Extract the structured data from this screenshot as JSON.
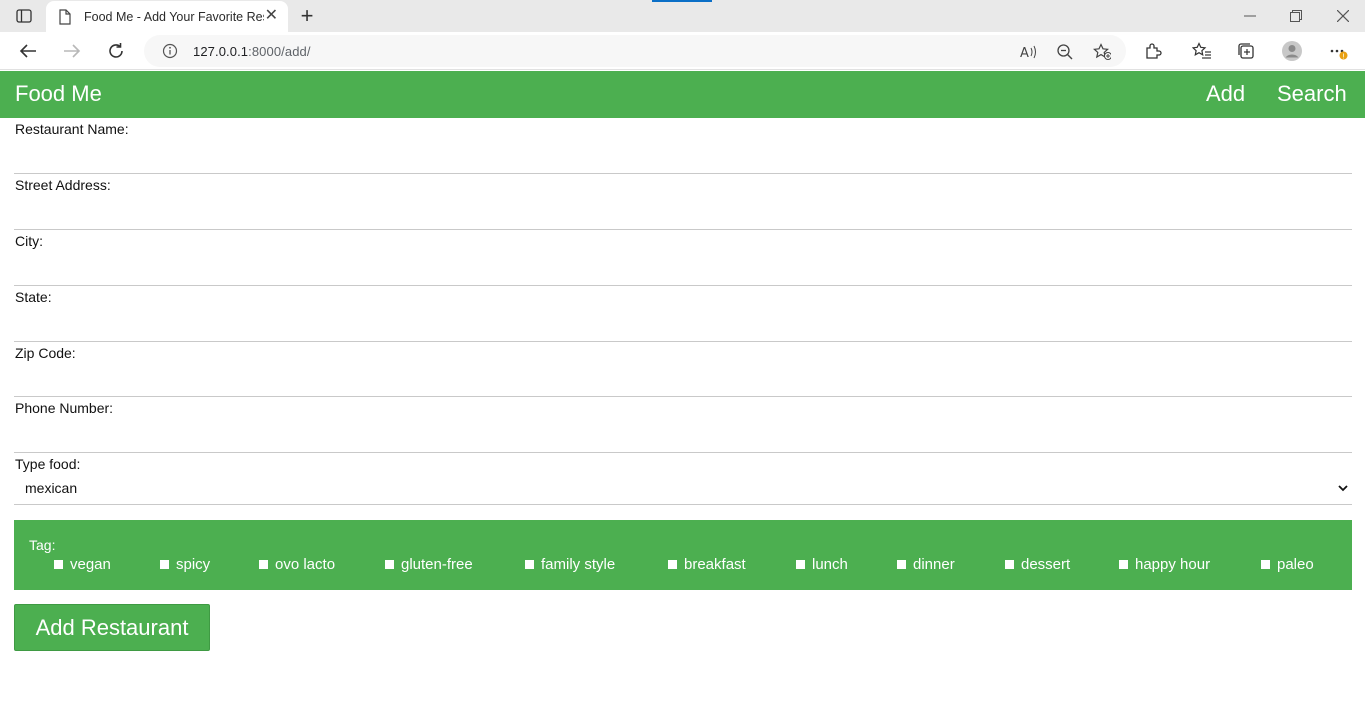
{
  "browser": {
    "tab_title": "Food Me - Add Your Favorite Res",
    "url_host": "127.0.0.1",
    "url_rest": ":8000/add/"
  },
  "header": {
    "brand": "Food Me",
    "links": [
      "Add",
      "Search"
    ]
  },
  "form": {
    "fields": [
      {
        "label": "Restaurant Name:",
        "value": ""
      },
      {
        "label": "Street Address:",
        "value": ""
      },
      {
        "label": "City:",
        "value": ""
      },
      {
        "label": "State:",
        "value": ""
      },
      {
        "label": "Zip Code:",
        "value": ""
      },
      {
        "label": "Phone Number:",
        "value": ""
      }
    ],
    "type_food": {
      "label": "Type food:",
      "selected": "mexican"
    },
    "tags": {
      "label": "Tag:",
      "options": [
        "vegan",
        "spicy",
        "ovo lacto",
        "gluten-free",
        "family style",
        "breakfast",
        "lunch",
        "dinner",
        "dessert",
        "happy hour",
        "paleo"
      ]
    },
    "submit_label": "Add Restaurant"
  },
  "colors": {
    "accent": "#4caf50",
    "browser_tab_accent": "#0b6fc7"
  }
}
